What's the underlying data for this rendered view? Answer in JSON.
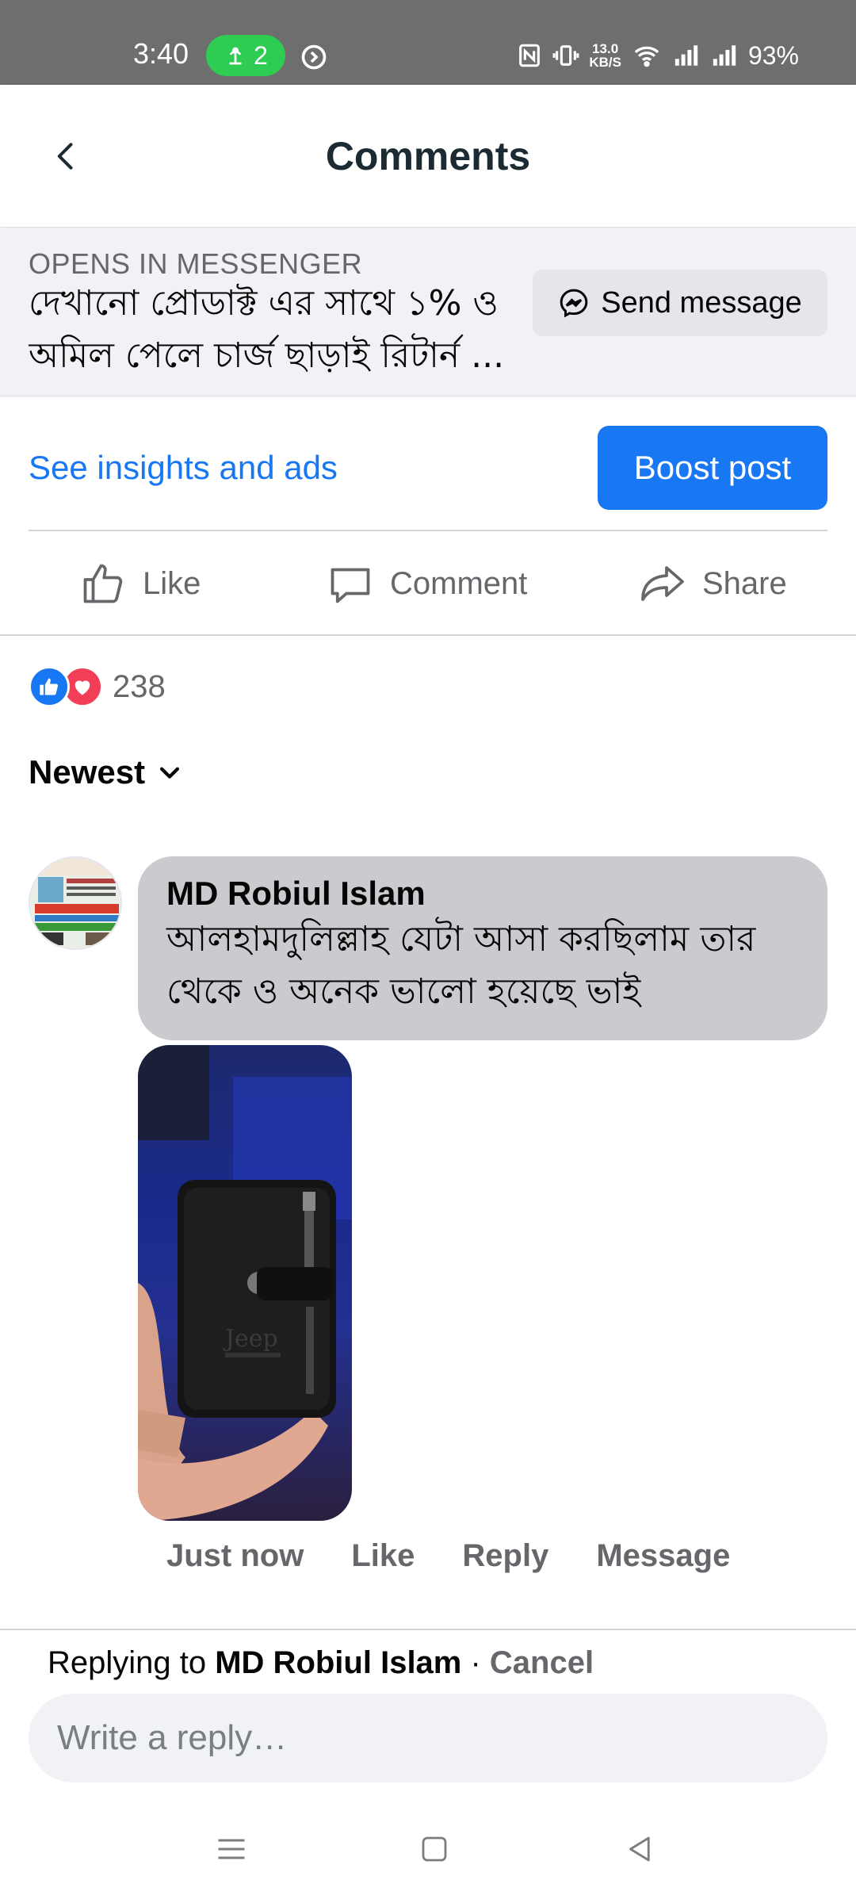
{
  "status_bar": {
    "time": "3:40",
    "hotspot_count": "2",
    "speed_value": "13.0",
    "speed_unit": "KB/S",
    "battery": "93%"
  },
  "header": {
    "title": "Comments",
    "back_icon": "chevron-left-icon"
  },
  "messenger_banner": {
    "label": "OPENS IN MESSENGER",
    "text": "দেখানো প্রোডাক্ট এর সাথে ১% ও অমিল পেলে চার্জ ছাড়াই রিটার্ন ...",
    "button_label": "Send message",
    "button_icon": "messenger-icon"
  },
  "insights": {
    "link_label": "See insights and ads",
    "boost_label": "Boost post",
    "accent_color": "#1877f2"
  },
  "actions": [
    {
      "label": "Like",
      "icon": "thumbs-up-icon"
    },
    {
      "label": "Comment",
      "icon": "comment-icon"
    },
    {
      "label": "Share",
      "icon": "share-icon"
    }
  ],
  "reactions": {
    "count": "238",
    "types": [
      "like",
      "love"
    ]
  },
  "sort": {
    "label": "Newest"
  },
  "comment": {
    "author": "MD Robiul Islam",
    "text": "আলহামদুলিল্লাহ যেটা আসা করছিলাম তার থেকে ও অনেক ভালো হয়েছে ভাই",
    "photo_caption": "Jeep",
    "time": "Just now",
    "like_label": "Like",
    "reply_label": "Reply",
    "message_label": "Message"
  },
  "composer": {
    "replying_prefix": "Replying to ",
    "replying_name": "MD Robiul Islam",
    "separator": " · ",
    "cancel_label": "Cancel",
    "placeholder": "Write a reply…"
  },
  "nav_bar": {
    "buttons": [
      "menu-icon",
      "home-square-icon",
      "back-triangle-icon"
    ]
  }
}
